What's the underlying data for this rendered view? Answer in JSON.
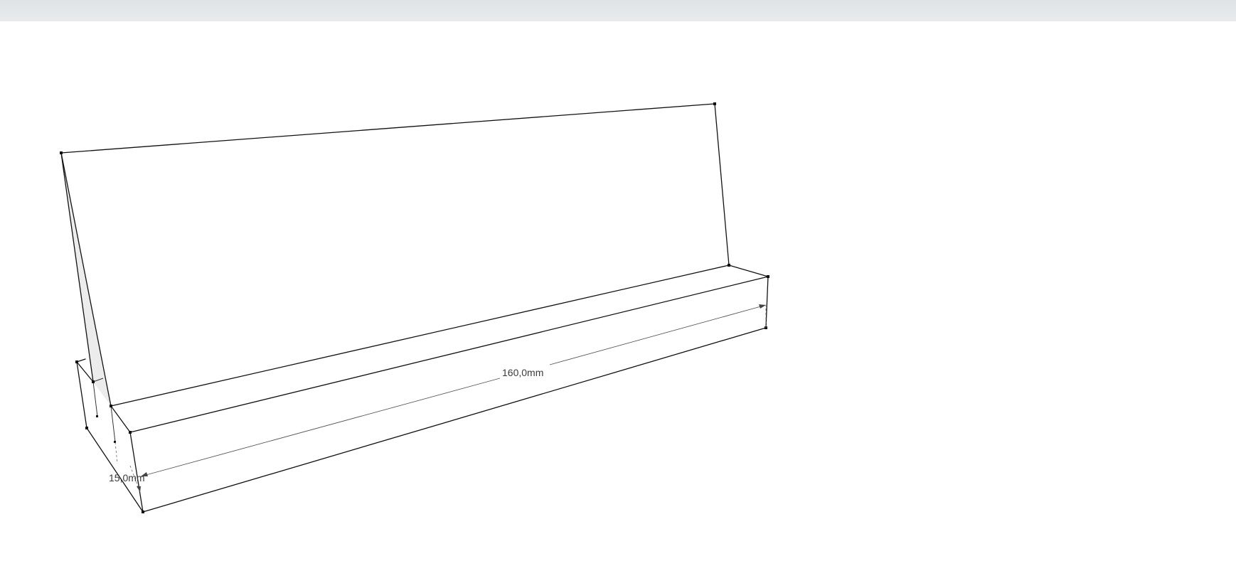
{
  "toolbar": {},
  "viewport": {
    "model": "shelf-stand",
    "dimensions": {
      "length_label": "160,0mm",
      "thickness_label": "15,0mm"
    }
  },
  "colors": {
    "toolbar_bg": "#e3e6e8",
    "edge": "#111111",
    "dimension": "#3a3a3a",
    "canvas": "#ffffff"
  }
}
